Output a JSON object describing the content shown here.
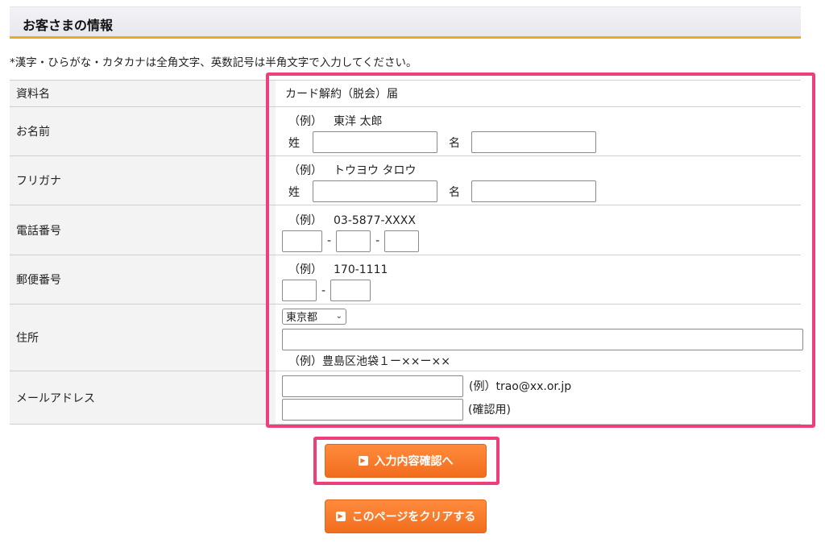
{
  "header": {
    "title": "お客さまの情報"
  },
  "note": "*漢字・ひらがな・カタカナは全角文字、英数記号は半角文字で入力してください。",
  "rows": {
    "material": {
      "label": "資料名",
      "value": "カード解約（脱会）届"
    },
    "name": {
      "label": "お名前",
      "example_prefix": "（例）",
      "example": "東洋 太郎",
      "sei": "姓",
      "mei": "名"
    },
    "furigana": {
      "label": "フリガナ",
      "example_prefix": "（例）",
      "example": "トウヨウ タロウ",
      "sei": "姓",
      "mei": "名"
    },
    "phone": {
      "label": "電話番号",
      "example_prefix": "（例）",
      "example": "03-5877-XXXX",
      "sep": "-"
    },
    "postal": {
      "label": "郵便番号",
      "example_prefix": "（例）",
      "example": "170-1111",
      "sep": "-"
    },
    "address": {
      "label": "住所",
      "prefecture": "東京都",
      "example_prefix": "（例）",
      "example": "豊島区池袋１ー××ー××"
    },
    "email": {
      "label": "メールアドレス",
      "example": "(例）trao@xx.or.jp",
      "confirm": "(確認用)"
    }
  },
  "buttons": {
    "confirm": "入力内容確認へ",
    "clear": "このページをクリアする"
  },
  "colors": {
    "accent": "#f0a81c",
    "highlight": "#ef3e7c",
    "button": "#f26d1e"
  },
  "icons": {
    "dropdown": "chevron-down-icon",
    "button": "arrow-right-icon"
  }
}
